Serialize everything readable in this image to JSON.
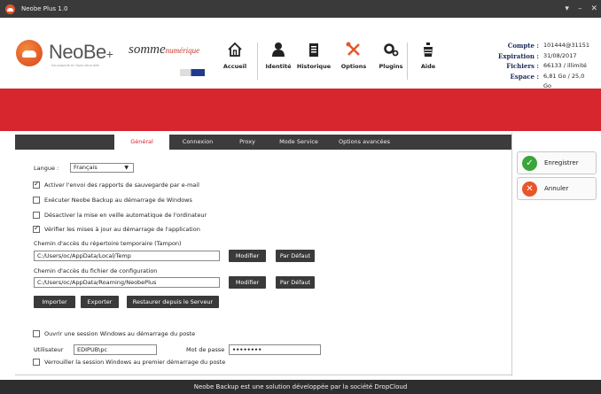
{
  "window": {
    "title": "Neobe Plus 1.0",
    "controls": [
      "▾",
      "–",
      "✕"
    ]
  },
  "brand": {
    "name": "NeoBe",
    "plus": "+",
    "tagline": "Sauvegarde en ligne sécurisée",
    "partner": "somme",
    "partner_accent": "numérique"
  },
  "nav": [
    {
      "label": "Accueil",
      "icon": "home-icon"
    },
    {
      "label": "Identité",
      "icon": "user-icon"
    },
    {
      "label": "Historique",
      "icon": "clipboard-icon"
    },
    {
      "label": "Options",
      "icon": "tools-icon"
    },
    {
      "label": "Plugins",
      "icon": "gears-icon"
    },
    {
      "label": "Aide",
      "icon": "help-icon"
    }
  ],
  "account": {
    "compte_label": "Compte :",
    "compte": "101444@31151",
    "expiration_label": "Expiration :",
    "expiration": "31/08/2017",
    "fichiers_label": "Fichiers :",
    "fichiers": "66133 / illimité",
    "espace_label": "Espace :",
    "espace": "6,81 Go / 25,0 Go"
  },
  "tabs": [
    "Général",
    "Connexion",
    "Proxy",
    "Mode Service",
    "Options avancées"
  ],
  "active_tab": "Général",
  "general": {
    "langue_label": "Langue :",
    "langue_value": "Français",
    "options": [
      {
        "label": "Activer l'envoi des rapports de sauvegarde par e-mail",
        "checked": true
      },
      {
        "label": "Exécuter Neobe Backup au démarrage de Windows",
        "checked": false
      },
      {
        "label": "Désactiver la mise en veille automatique de l'ordinateur",
        "checked": false
      },
      {
        "label": "Vérifier les mises à jour au démarrage de l'application",
        "checked": true
      }
    ],
    "temp_label": "Chemin d'accès du répertoire temporaire (Tampon)",
    "temp_value": "C:/Users/oc/AppData/Local/Temp",
    "config_label": "Chemin d'accès du fichier de configuration",
    "config_value": "C:/Users/oc/AppData/Roaming/NeobePlus",
    "modifier": "Modifier",
    "par_defaut": "Par Défaut",
    "importer": "Importer",
    "exporter": "Exporter",
    "restaurer": "Restaurer depuis le Serveur",
    "session_label": "Ouvrir une session Windows au démarrage du poste",
    "utilisateur_label": "Utilisateur",
    "utilisateur_value": "EDIPUB\\pc",
    "mdp_label": "Mot de passe",
    "mdp_value": "••••••••",
    "verrouiller_label": "Verrouiller la session Windows au premier démarrage du poste"
  },
  "side": {
    "save": "Enregistrer",
    "cancel": "Annuler"
  },
  "footer": "Neobe Backup est une solution développée par la société DropCloud",
  "colors": {
    "accent_red": "#d8262e",
    "dark": "#3a3a3a",
    "save_green": "#3aa53a",
    "cancel_orange": "#e8552a"
  }
}
